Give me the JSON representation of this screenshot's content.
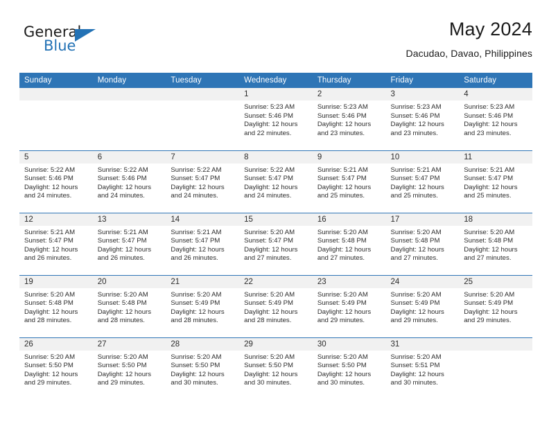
{
  "brand": {
    "name_primary": "General",
    "name_secondary": "Blue",
    "accent_color": "#2372b5"
  },
  "header": {
    "month_title": "May 2024",
    "location": "Dacudao, Davao, Philippines"
  },
  "calendar": {
    "header_color": "#2e75b6",
    "daynum_band_color": "#f1f1f1",
    "weekday_headers": [
      "Sunday",
      "Monday",
      "Tuesday",
      "Wednesday",
      "Thursday",
      "Friday",
      "Saturday"
    ],
    "weeks": [
      [
        {
          "empty": true
        },
        {
          "empty": true
        },
        {
          "empty": true
        },
        {
          "day": "1",
          "sunrise": "Sunrise: 5:23 AM",
          "sunset": "Sunset: 5:46 PM",
          "daylight_line1": "Daylight: 12 hours",
          "daylight_line2": "and 22 minutes."
        },
        {
          "day": "2",
          "sunrise": "Sunrise: 5:23 AM",
          "sunset": "Sunset: 5:46 PM",
          "daylight_line1": "Daylight: 12 hours",
          "daylight_line2": "and 23 minutes."
        },
        {
          "day": "3",
          "sunrise": "Sunrise: 5:23 AM",
          "sunset": "Sunset: 5:46 PM",
          "daylight_line1": "Daylight: 12 hours",
          "daylight_line2": "and 23 minutes."
        },
        {
          "day": "4",
          "sunrise": "Sunrise: 5:23 AM",
          "sunset": "Sunset: 5:46 PM",
          "daylight_line1": "Daylight: 12 hours",
          "daylight_line2": "and 23 minutes."
        }
      ],
      [
        {
          "day": "5",
          "sunrise": "Sunrise: 5:22 AM",
          "sunset": "Sunset: 5:46 PM",
          "daylight_line1": "Daylight: 12 hours",
          "daylight_line2": "and 24 minutes."
        },
        {
          "day": "6",
          "sunrise": "Sunrise: 5:22 AM",
          "sunset": "Sunset: 5:46 PM",
          "daylight_line1": "Daylight: 12 hours",
          "daylight_line2": "and 24 minutes."
        },
        {
          "day": "7",
          "sunrise": "Sunrise: 5:22 AM",
          "sunset": "Sunset: 5:47 PM",
          "daylight_line1": "Daylight: 12 hours",
          "daylight_line2": "and 24 minutes."
        },
        {
          "day": "8",
          "sunrise": "Sunrise: 5:22 AM",
          "sunset": "Sunset: 5:47 PM",
          "daylight_line1": "Daylight: 12 hours",
          "daylight_line2": "and 24 minutes."
        },
        {
          "day": "9",
          "sunrise": "Sunrise: 5:21 AM",
          "sunset": "Sunset: 5:47 PM",
          "daylight_line1": "Daylight: 12 hours",
          "daylight_line2": "and 25 minutes."
        },
        {
          "day": "10",
          "sunrise": "Sunrise: 5:21 AM",
          "sunset": "Sunset: 5:47 PM",
          "daylight_line1": "Daylight: 12 hours",
          "daylight_line2": "and 25 minutes."
        },
        {
          "day": "11",
          "sunrise": "Sunrise: 5:21 AM",
          "sunset": "Sunset: 5:47 PM",
          "daylight_line1": "Daylight: 12 hours",
          "daylight_line2": "and 25 minutes."
        }
      ],
      [
        {
          "day": "12",
          "sunrise": "Sunrise: 5:21 AM",
          "sunset": "Sunset: 5:47 PM",
          "daylight_line1": "Daylight: 12 hours",
          "daylight_line2": "and 26 minutes."
        },
        {
          "day": "13",
          "sunrise": "Sunrise: 5:21 AM",
          "sunset": "Sunset: 5:47 PM",
          "daylight_line1": "Daylight: 12 hours",
          "daylight_line2": "and 26 minutes."
        },
        {
          "day": "14",
          "sunrise": "Sunrise: 5:21 AM",
          "sunset": "Sunset: 5:47 PM",
          "daylight_line1": "Daylight: 12 hours",
          "daylight_line2": "and 26 minutes."
        },
        {
          "day": "15",
          "sunrise": "Sunrise: 5:20 AM",
          "sunset": "Sunset: 5:47 PM",
          "daylight_line1": "Daylight: 12 hours",
          "daylight_line2": "and 27 minutes."
        },
        {
          "day": "16",
          "sunrise": "Sunrise: 5:20 AM",
          "sunset": "Sunset: 5:48 PM",
          "daylight_line1": "Daylight: 12 hours",
          "daylight_line2": "and 27 minutes."
        },
        {
          "day": "17",
          "sunrise": "Sunrise: 5:20 AM",
          "sunset": "Sunset: 5:48 PM",
          "daylight_line1": "Daylight: 12 hours",
          "daylight_line2": "and 27 minutes."
        },
        {
          "day": "18",
          "sunrise": "Sunrise: 5:20 AM",
          "sunset": "Sunset: 5:48 PM",
          "daylight_line1": "Daylight: 12 hours",
          "daylight_line2": "and 27 minutes."
        }
      ],
      [
        {
          "day": "19",
          "sunrise": "Sunrise: 5:20 AM",
          "sunset": "Sunset: 5:48 PM",
          "daylight_line1": "Daylight: 12 hours",
          "daylight_line2": "and 28 minutes."
        },
        {
          "day": "20",
          "sunrise": "Sunrise: 5:20 AM",
          "sunset": "Sunset: 5:48 PM",
          "daylight_line1": "Daylight: 12 hours",
          "daylight_line2": "and 28 minutes."
        },
        {
          "day": "21",
          "sunrise": "Sunrise: 5:20 AM",
          "sunset": "Sunset: 5:49 PM",
          "daylight_line1": "Daylight: 12 hours",
          "daylight_line2": "and 28 minutes."
        },
        {
          "day": "22",
          "sunrise": "Sunrise: 5:20 AM",
          "sunset": "Sunset: 5:49 PM",
          "daylight_line1": "Daylight: 12 hours",
          "daylight_line2": "and 28 minutes."
        },
        {
          "day": "23",
          "sunrise": "Sunrise: 5:20 AM",
          "sunset": "Sunset: 5:49 PM",
          "daylight_line1": "Daylight: 12 hours",
          "daylight_line2": "and 29 minutes."
        },
        {
          "day": "24",
          "sunrise": "Sunrise: 5:20 AM",
          "sunset": "Sunset: 5:49 PM",
          "daylight_line1": "Daylight: 12 hours",
          "daylight_line2": "and 29 minutes."
        },
        {
          "day": "25",
          "sunrise": "Sunrise: 5:20 AM",
          "sunset": "Sunset: 5:49 PM",
          "daylight_line1": "Daylight: 12 hours",
          "daylight_line2": "and 29 minutes."
        }
      ],
      [
        {
          "day": "26",
          "sunrise": "Sunrise: 5:20 AM",
          "sunset": "Sunset: 5:50 PM",
          "daylight_line1": "Daylight: 12 hours",
          "daylight_line2": "and 29 minutes."
        },
        {
          "day": "27",
          "sunrise": "Sunrise: 5:20 AM",
          "sunset": "Sunset: 5:50 PM",
          "daylight_line1": "Daylight: 12 hours",
          "daylight_line2": "and 29 minutes."
        },
        {
          "day": "28",
          "sunrise": "Sunrise: 5:20 AM",
          "sunset": "Sunset: 5:50 PM",
          "daylight_line1": "Daylight: 12 hours",
          "daylight_line2": "and 30 minutes."
        },
        {
          "day": "29",
          "sunrise": "Sunrise: 5:20 AM",
          "sunset": "Sunset: 5:50 PM",
          "daylight_line1": "Daylight: 12 hours",
          "daylight_line2": "and 30 minutes."
        },
        {
          "day": "30",
          "sunrise": "Sunrise: 5:20 AM",
          "sunset": "Sunset: 5:50 PM",
          "daylight_line1": "Daylight: 12 hours",
          "daylight_line2": "and 30 minutes."
        },
        {
          "day": "31",
          "sunrise": "Sunrise: 5:20 AM",
          "sunset": "Sunset: 5:51 PM",
          "daylight_line1": "Daylight: 12 hours",
          "daylight_line2": "and 30 minutes."
        },
        {
          "empty": true
        }
      ]
    ]
  }
}
